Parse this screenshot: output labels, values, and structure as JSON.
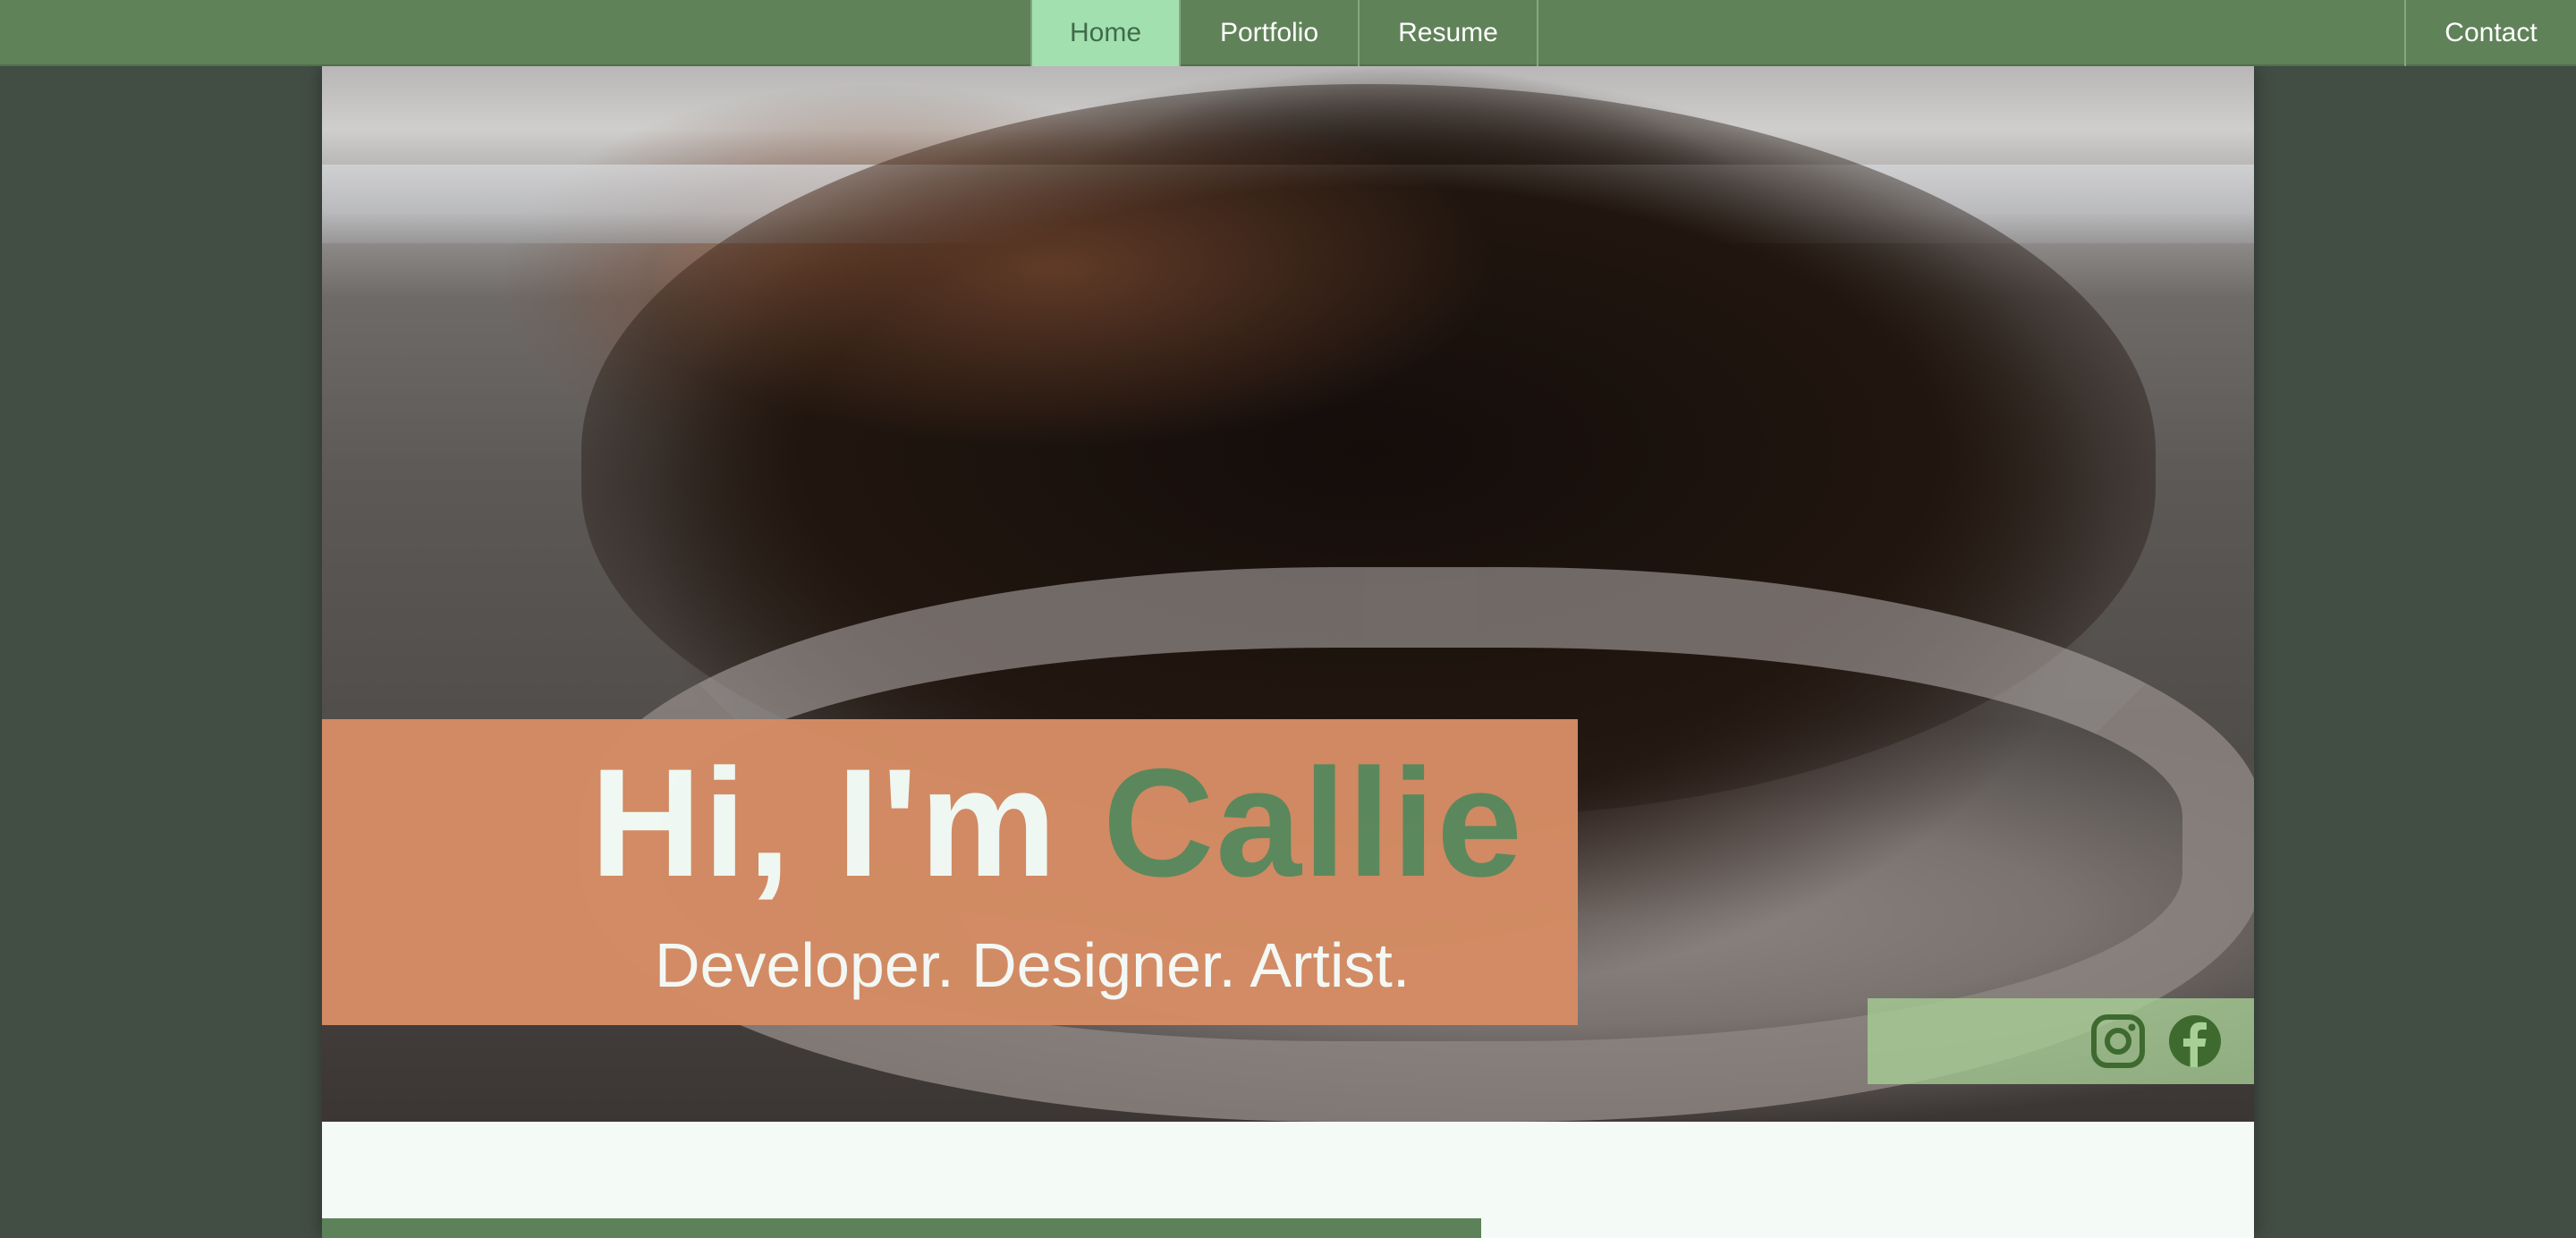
{
  "nav": {
    "items": [
      {
        "label": "Home",
        "active": true
      },
      {
        "label": "Portfolio",
        "active": false
      },
      {
        "label": "Resume",
        "active": false
      }
    ],
    "contact_label": "Contact"
  },
  "hero": {
    "greeting_prefix": "Hi, I'm",
    "name": "Callie",
    "tagline": "Developer. Designer. Artist.",
    "social": [
      {
        "icon": "instagram-icon"
      },
      {
        "icon": "facebook-icon"
      }
    ]
  },
  "colors": {
    "nav_bg": "#608259",
    "nav_active_bg": "#a3e0b0",
    "page_bg": "#424d44",
    "greeting_box": "#d48c64",
    "name_accent": "#5d8a5f",
    "social_box": "#a8d096",
    "social_icon": "#3e6a2f"
  }
}
